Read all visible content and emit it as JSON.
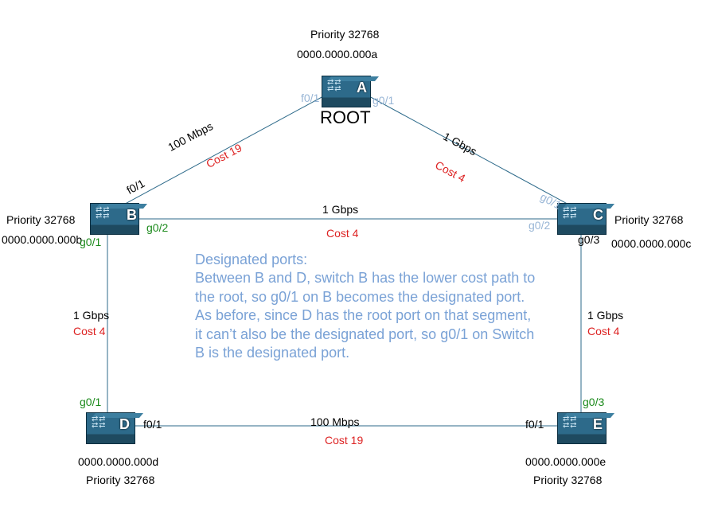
{
  "switches": {
    "A": {
      "letter": "A",
      "priority": "Priority 32768",
      "mac": "0000.0000.000a",
      "root_label": "ROOT"
    },
    "B": {
      "letter": "B",
      "priority": "Priority 32768",
      "mac": "0000.0000.000b"
    },
    "C": {
      "letter": "C",
      "priority": "Priority 32768",
      "mac": "0000.0000.000c"
    },
    "D": {
      "letter": "D",
      "priority": "Priority 32768",
      "mac": "0000.0000.000d"
    },
    "E": {
      "letter": "E",
      "priority": "Priority 32768",
      "mac": "0000.0000.000e"
    }
  },
  "links": {
    "AB": {
      "speed": "100 Mbps",
      "cost": "Cost 19"
    },
    "AC": {
      "speed": "1 Gbps",
      "cost": "Cost 4"
    },
    "BC": {
      "speed": "1 Gbps",
      "cost": "Cost 4"
    },
    "BD": {
      "speed": "1 Gbps",
      "cost": "Cost 4"
    },
    "CE": {
      "speed": "1 Gbps",
      "cost": "Cost 4"
    },
    "DE": {
      "speed": "100  Mbps",
      "cost": "Cost 19"
    }
  },
  "ports": {
    "A_left": "f0/1",
    "A_right": "g0/1",
    "B_up": "f0/1",
    "B_right": "g0/2",
    "B_down": "g0/1",
    "C_up": "g0/1",
    "C_left": "g0/2",
    "C_down": "g0/3",
    "D_up": "g0/1",
    "D_right": "f0/1",
    "E_up": "g0/3",
    "E_left": "f0/1"
  },
  "explain": {
    "title": "Designated ports:",
    "body": "Between B and D, switch B has the lower cost path to the root, so g0/1 on B becomes the designated port.  As before, since D has the root port on that segment, it can’t also be the designated port, so g0/1 on Switch B is the designated port."
  }
}
